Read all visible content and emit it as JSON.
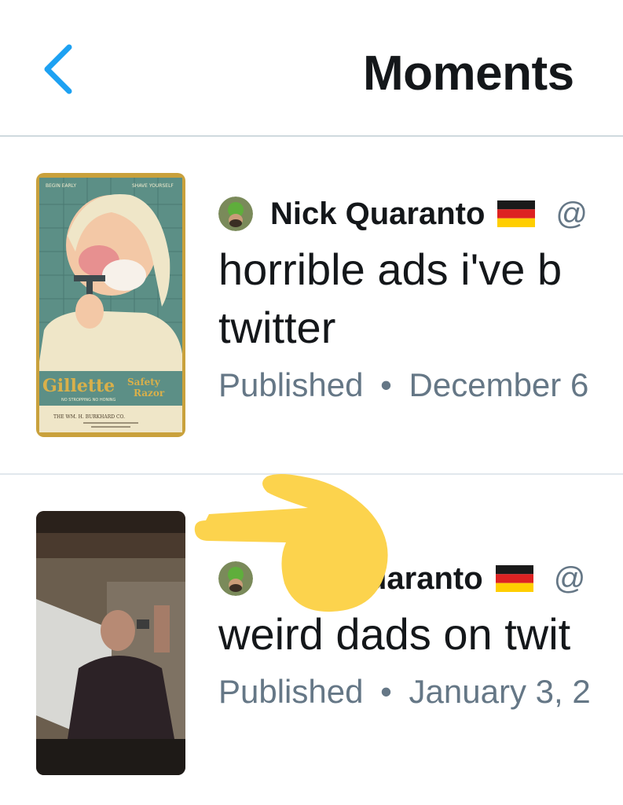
{
  "header": {
    "title": "Moments",
    "back_icon": "chevron-left-icon",
    "accent_color": "#1da1f2"
  },
  "moments": [
    {
      "author": "Nick Quaranto",
      "flag": "germany-flag-icon",
      "handle": "@",
      "title": "horrible ads i've b twitter",
      "status": "Published",
      "separator": "•",
      "date": "December 6",
      "thumbnail_text": {
        "top_left": "BEGIN EARLY",
        "top_right": "SHAVE YOURSELF",
        "brand": "Gillette",
        "product_top": "Safety",
        "product_bottom": "Razor",
        "tagline": "NO STROPPING NO HONING",
        "footer": "THE WM. H. BURKHARD CO."
      }
    },
    {
      "author": "Nick Quaranto",
      "author_visible_suffix": "uaranto",
      "flag": "germany-flag-icon",
      "handle": "@",
      "title": "weird dads on twit",
      "status": "Published",
      "separator": "•",
      "date": "January 3, 2"
    }
  ],
  "overlay": {
    "icon": "pointing-hand-emoji-icon",
    "color": "#fcd34d"
  }
}
